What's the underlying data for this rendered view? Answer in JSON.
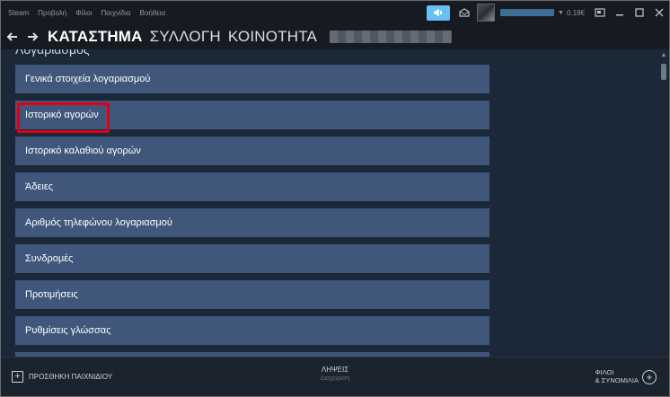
{
  "menu": {
    "items": [
      {
        "label": "Steam"
      },
      {
        "label": "Προβολή"
      },
      {
        "label": "Φίλοι"
      },
      {
        "label": "Παιχνίδια"
      },
      {
        "label": "Βοήθεια"
      }
    ]
  },
  "account": {
    "balance": "0.18€"
  },
  "nav": {
    "store": "ΚΑΤΑΣΤΗΜΑ",
    "library": "ΣΥΛΛΟΓΗ",
    "community": "ΚΟΙΝΟΤΗΤΑ"
  },
  "content": {
    "section_title": "Λογαριασμός",
    "items": [
      {
        "label": "Γενικά στοιχεία λογαριασμού"
      },
      {
        "label": "Ιστορικό αγορών"
      },
      {
        "label": "Ιστορικό καλαθιού αγορών"
      },
      {
        "label": "Άδειες"
      },
      {
        "label": "Αριθμός τηλεφώνου λογαριασμού"
      },
      {
        "label": "Συνδρομές"
      },
      {
        "label": "Προτιμήσεις"
      },
      {
        "label": "Ρυθμίσεις γλώσσας"
      }
    ]
  },
  "bottom": {
    "add_game": "ΠΡΟΣΘΗΚΗ ΠΑΙΧΝΙΔΙΟΥ",
    "downloads_title": "ΛΗΨΕΙΣ",
    "downloads_sub": "Διαχείριση",
    "friends_line1": "ΦΙΛΟΙ",
    "friends_line2": "& ΣΥΝΟΜΙΛΙΑ"
  },
  "colors": {
    "accent": "#66c0f4",
    "item_bg": "#40577b",
    "highlight": "#e00012",
    "bg": "#1b2838"
  }
}
